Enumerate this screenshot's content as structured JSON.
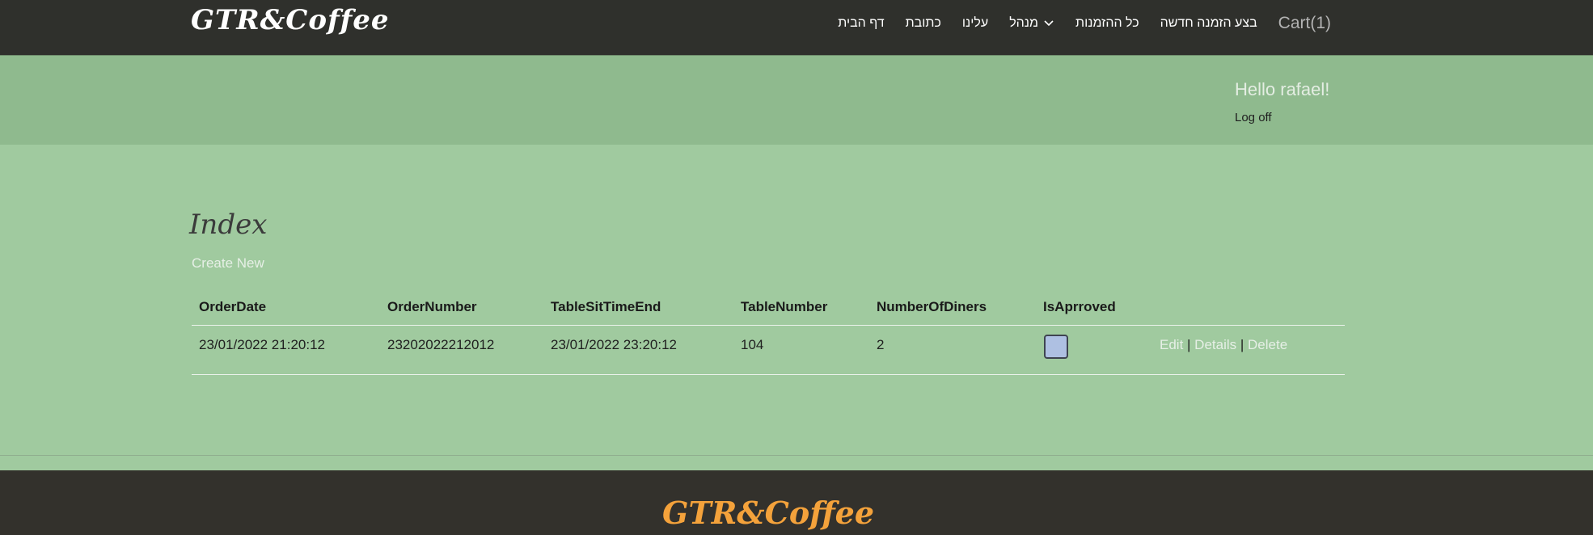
{
  "header": {
    "brand": "GTR&Coffee",
    "nav": {
      "cart": "Cart(1)",
      "new_order": "בצע הזמנה חדשה",
      "all_orders": "כל ההזמנות",
      "admin": "מנהל",
      "about": "עלינו",
      "address": "כתובת",
      "home": "דף הבית"
    }
  },
  "hero": {
    "greeting": "Hello rafael!",
    "logoff": "Log off"
  },
  "main": {
    "title": "Index",
    "create_new": "Create New",
    "table": {
      "headers": [
        "OrderDate",
        "OrderNumber",
        "TableSitTimeEnd",
        "TableNumber",
        "NumberOfDiners",
        "IsAprroved"
      ],
      "rows": [
        {
          "order_date": "23/01/2022 21:20:12",
          "order_number": "23202022212012",
          "table_sit_time_end": "23/01/2022 23:20:12",
          "table_number": "104",
          "number_of_diners": "2",
          "is_approved": false,
          "actions": {
            "edit": "Edit",
            "sep": "|",
            "details": "Details",
            "delete": "Delete"
          }
        }
      ]
    }
  },
  "footer": {
    "brand": "GTR&Coffee"
  },
  "colors": {
    "topbar": "#2f302c",
    "hero": "#8fba8e",
    "page_bg": "#a0ca9f",
    "footer": "#33312c",
    "footer_brand": "#f4a23b"
  }
}
